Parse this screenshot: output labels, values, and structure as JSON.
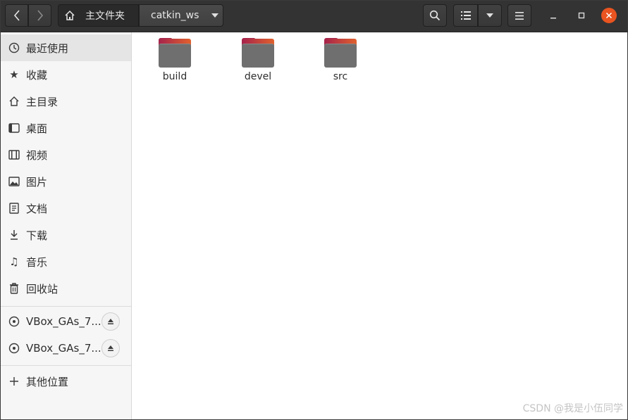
{
  "header": {
    "path_home_label": "主文件夹",
    "path_current": "catkin_ws"
  },
  "icons": {
    "back": "chevron-left-icon",
    "forward": "chevron-right-icon",
    "home": "home-icon",
    "search": "search-icon",
    "list_view": "list-view-icon",
    "menu": "hamburger-icon",
    "minimize": "minimize-icon",
    "maximize": "maximize-icon",
    "close": "close-icon"
  },
  "sidebar": {
    "places": [
      {
        "label": "最近使用",
        "icon": "clock-icon",
        "active": true
      },
      {
        "label": "收藏",
        "icon": "star-icon"
      },
      {
        "label": "主目录",
        "icon": "home-icon"
      },
      {
        "label": "桌面",
        "icon": "desktop-icon"
      },
      {
        "label": "视频",
        "icon": "film-icon"
      },
      {
        "label": "图片",
        "icon": "image-icon"
      },
      {
        "label": "文档",
        "icon": "document-icon"
      },
      {
        "label": "下载",
        "icon": "download-icon"
      },
      {
        "label": "音乐",
        "icon": "music-icon"
      },
      {
        "label": "回收站",
        "icon": "trash-icon"
      }
    ],
    "devices": [
      {
        "label": "VBox_GAs_7....",
        "icon": "disc-icon"
      },
      {
        "label": "VBox_GAs_7....",
        "icon": "disc-icon"
      }
    ],
    "other_locations": {
      "label": "其他位置",
      "icon": "plus-icon"
    }
  },
  "files": [
    {
      "name": "build"
    },
    {
      "name": "devel"
    },
    {
      "name": "src"
    }
  ],
  "watermark": "CSDN @我是小伍同学",
  "colors": {
    "headerbar": "#333333",
    "close_button": "#e95420",
    "folder_gradient_start": "#a6234c",
    "folder_gradient_end": "#e0612d",
    "folder_body": "#6f6f6f"
  }
}
